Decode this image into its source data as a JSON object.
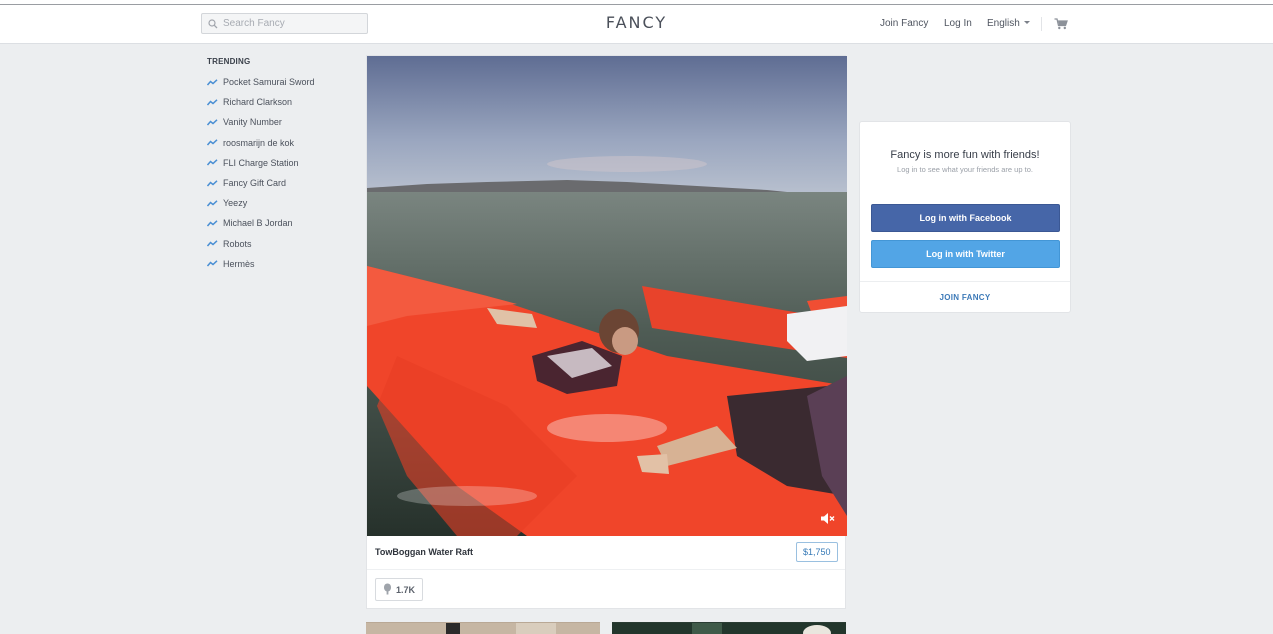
{
  "header": {
    "search_placeholder": "Search Fancy",
    "logo": "FANCY",
    "nav": {
      "join": "Join Fancy",
      "login": "Log In",
      "language": "English"
    },
    "icons": [
      "search-icon",
      "cart-icon",
      "chevron-down-icon"
    ]
  },
  "trending": {
    "title": "TRENDING",
    "items": [
      "Pocket Samurai Sword",
      "Richard Clarkson",
      "Vanity Number",
      "roosmarijn de kok",
      "FLI Charge Station",
      "Fancy Gift Card",
      "Yeezy",
      "Michael B Jordan",
      "Robots",
      "Hermès"
    ]
  },
  "item": {
    "title": "TowBoggan Water Raft",
    "price": "$1,750",
    "fancy_count": "1.7K"
  },
  "signup": {
    "title": "Fancy is more fun with friends!",
    "subtitle": "Log in to see what your friends are up to.",
    "facebook": "Log in with Facebook",
    "twitter": "Log in with Twitter",
    "join": "JOIN FANCY"
  },
  "colors": {
    "facebook": "#4666a8",
    "twitter": "#52a5e6",
    "link": "#3d7ab8",
    "background": "#eceef0",
    "raft": "#f0452a"
  }
}
